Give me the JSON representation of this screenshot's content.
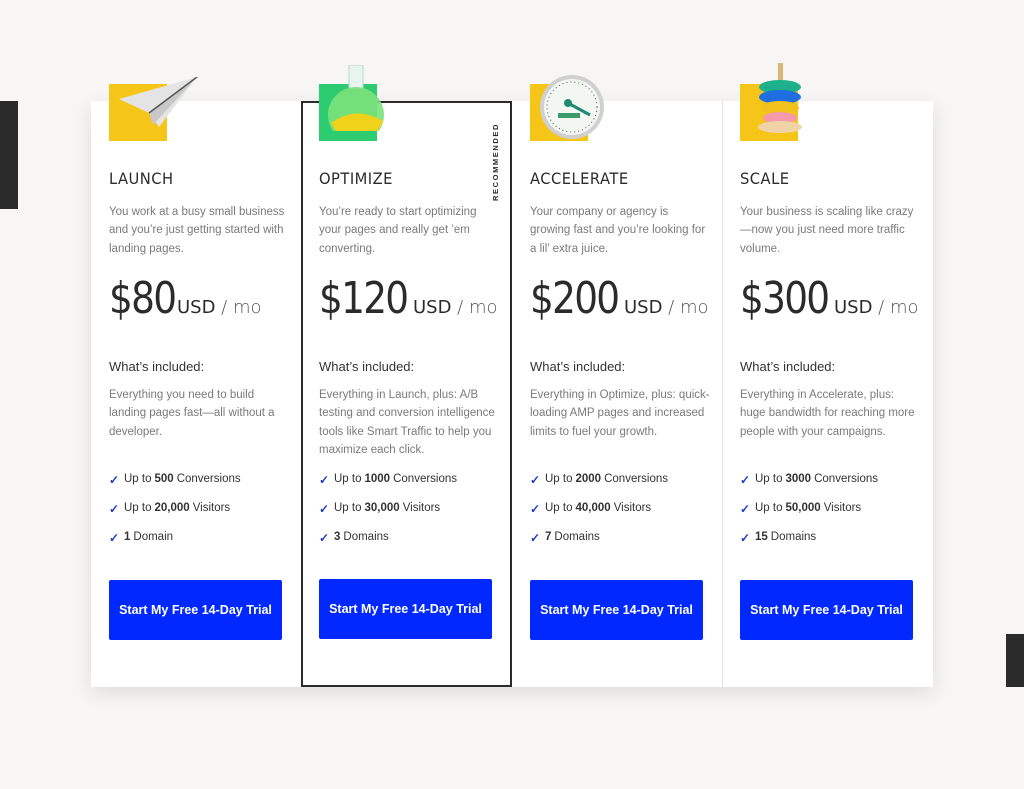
{
  "colors": {
    "accent": "#0028ff",
    "check": "#1d3bc8",
    "text": "#2b2b2b",
    "muted": "#7a7a7a"
  },
  "recommended_badge": "RECOMMENDED",
  "plans": [
    {
      "name": "LAUNCH",
      "icon": "paper-airplane",
      "description": "You work at a busy small business and you’re just getting started with landing pages.",
      "price": "$80",
      "currency": "USD",
      "period": " / mo",
      "included_heading": "What’s included:",
      "included_text": "Everything you need to build landing pages fast—all without a developer.",
      "features": [
        {
          "prefix": "Up to",
          "value": "500",
          "suffix": "Conversions"
        },
        {
          "prefix": "Up to",
          "value": "20,000",
          "suffix": "Visitors"
        },
        {
          "prefix": "",
          "value": "1",
          "suffix": "Domain"
        }
      ],
      "cta": "Start My Free 14-Day Trial"
    },
    {
      "name": "OPTIMIZE",
      "icon": "flask",
      "description": "You’re ready to start optimizing your pages and really get ’em converting.",
      "price": "$120",
      "currency": "USD",
      "period": " / mo",
      "included_heading": "What’s included:",
      "included_text": "Everything in Launch, plus: A/B testing and conversion intelligence tools like Smart Traffic to help you maximize each click.",
      "features": [
        {
          "prefix": "Up to",
          "value": "1000",
          "suffix": "Conversions"
        },
        {
          "prefix": "Up to",
          "value": "30,000",
          "suffix": "Visitors"
        },
        {
          "prefix": "",
          "value": "3",
          "suffix": "Domains"
        }
      ],
      "cta": "Start My Free 14-Day Trial"
    },
    {
      "name": "ACCELERATE",
      "icon": "speedometer",
      "description": "Your company or agency is growing fast and you’re looking for a lil’ extra juice.",
      "price": "$200",
      "currency": "USD",
      "period": " / mo",
      "included_heading": "What’s included:",
      "included_text": "Everything in Optimize, plus: quick-loading AMP pages and increased limits to fuel your growth.",
      "features": [
        {
          "prefix": "Up to",
          "value": "2000",
          "suffix": "Conversions"
        },
        {
          "prefix": "Up to",
          "value": "40,000",
          "suffix": "Visitors"
        },
        {
          "prefix": "",
          "value": "7",
          "suffix": "Domains"
        }
      ],
      "cta": "Start My Free 14-Day Trial"
    },
    {
      "name": "SCALE",
      "icon": "stacking-rings-toy",
      "description": "Your business is scaling like crazy—now you just need more traffic volume.",
      "price": "$300",
      "currency": "USD",
      "period": " / mo",
      "included_heading": "What’s included:",
      "included_text": "Everything in Accelerate, plus: huge bandwidth for reaching more people with your campaigns.",
      "features": [
        {
          "prefix": "Up to",
          "value": "3000",
          "suffix": "Conversions"
        },
        {
          "prefix": "Up to",
          "value": "50,000",
          "suffix": "Visitors"
        },
        {
          "prefix": "",
          "value": "15",
          "suffix": "Domains"
        }
      ],
      "cta": "Start My Free 14-Day Trial"
    }
  ]
}
